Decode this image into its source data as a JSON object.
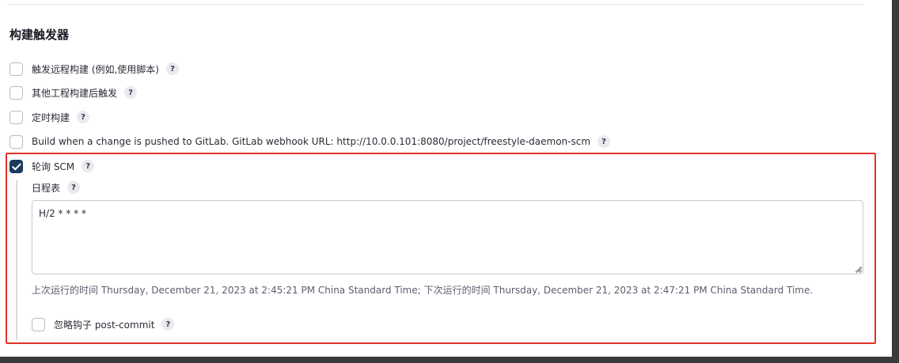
{
  "section": {
    "title": "构建触发器"
  },
  "triggers": [
    {
      "label": "触发远程构建 (例如,使用脚本)",
      "checked": false
    },
    {
      "label": "其他工程构建后触发",
      "checked": false
    },
    {
      "label": "定时构建",
      "checked": false
    },
    {
      "label": "Build when a change is pushed to GitLab. GitLab webhook URL: http://10.0.0.101:8080/project/freestyle-daemon-scm",
      "checked": false
    },
    {
      "label": "轮询 SCM",
      "checked": true
    }
  ],
  "poll_scm": {
    "schedule_label": "日程表",
    "schedule_value": "H/2 * * * *",
    "schedule_info": "上次运行的时间 Thursday, December 21, 2023 at 2:45:21 PM China Standard Time; 下次运行的时间 Thursday, December 21, 2023 at 2:47:21 PM China Standard Time.",
    "ignore_post_commit_label": "忽略钩子 post-commit",
    "ignore_post_commit_checked": false
  },
  "help_symbol": "?",
  "icons": {
    "help": "question-circle-icon",
    "checkmark": "checkmark-icon"
  },
  "colors": {
    "checked_box": "#1a3b5c",
    "highlight_border": "#e1322a"
  }
}
